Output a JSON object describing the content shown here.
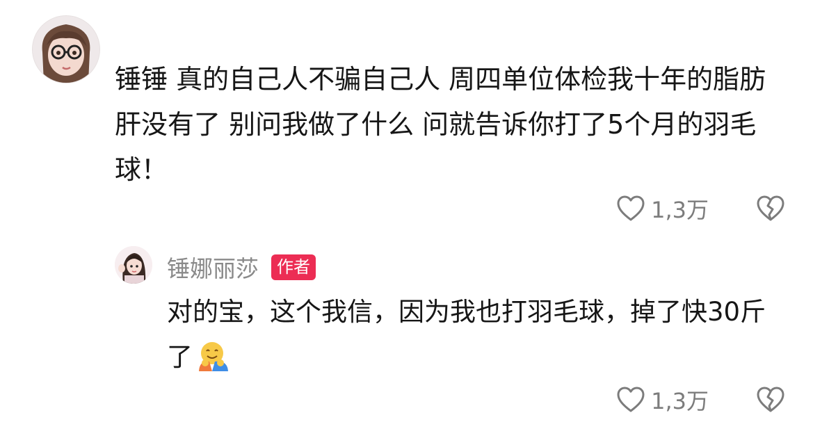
{
  "comment": {
    "text": "锤锤 真的自己人不骗自己人 周四单位体检我十年的脂肪肝没有了 别问我做了什么 问就告诉你打了5个月的羽毛球！",
    "likes": "1,3万",
    "avatar_icon": "glasses-girl-avatar",
    "like_icon": "heart-outline-icon",
    "dislike_icon": "broken-heart-icon"
  },
  "reply": {
    "author": "锤娜丽莎",
    "badge": "作者",
    "text": "对的宝，这个我信，因为我也打羽毛球，掉了快30斤了",
    "emoji_icon": "hugging-face-emoji",
    "likes": "1,3万",
    "avatar_icon": "girl-waving-avatar"
  },
  "colors": {
    "badge": "#ec2d54",
    "author_name": "#8a8a8a",
    "icon_gray": "#7c7c7c",
    "text": "#161616"
  }
}
